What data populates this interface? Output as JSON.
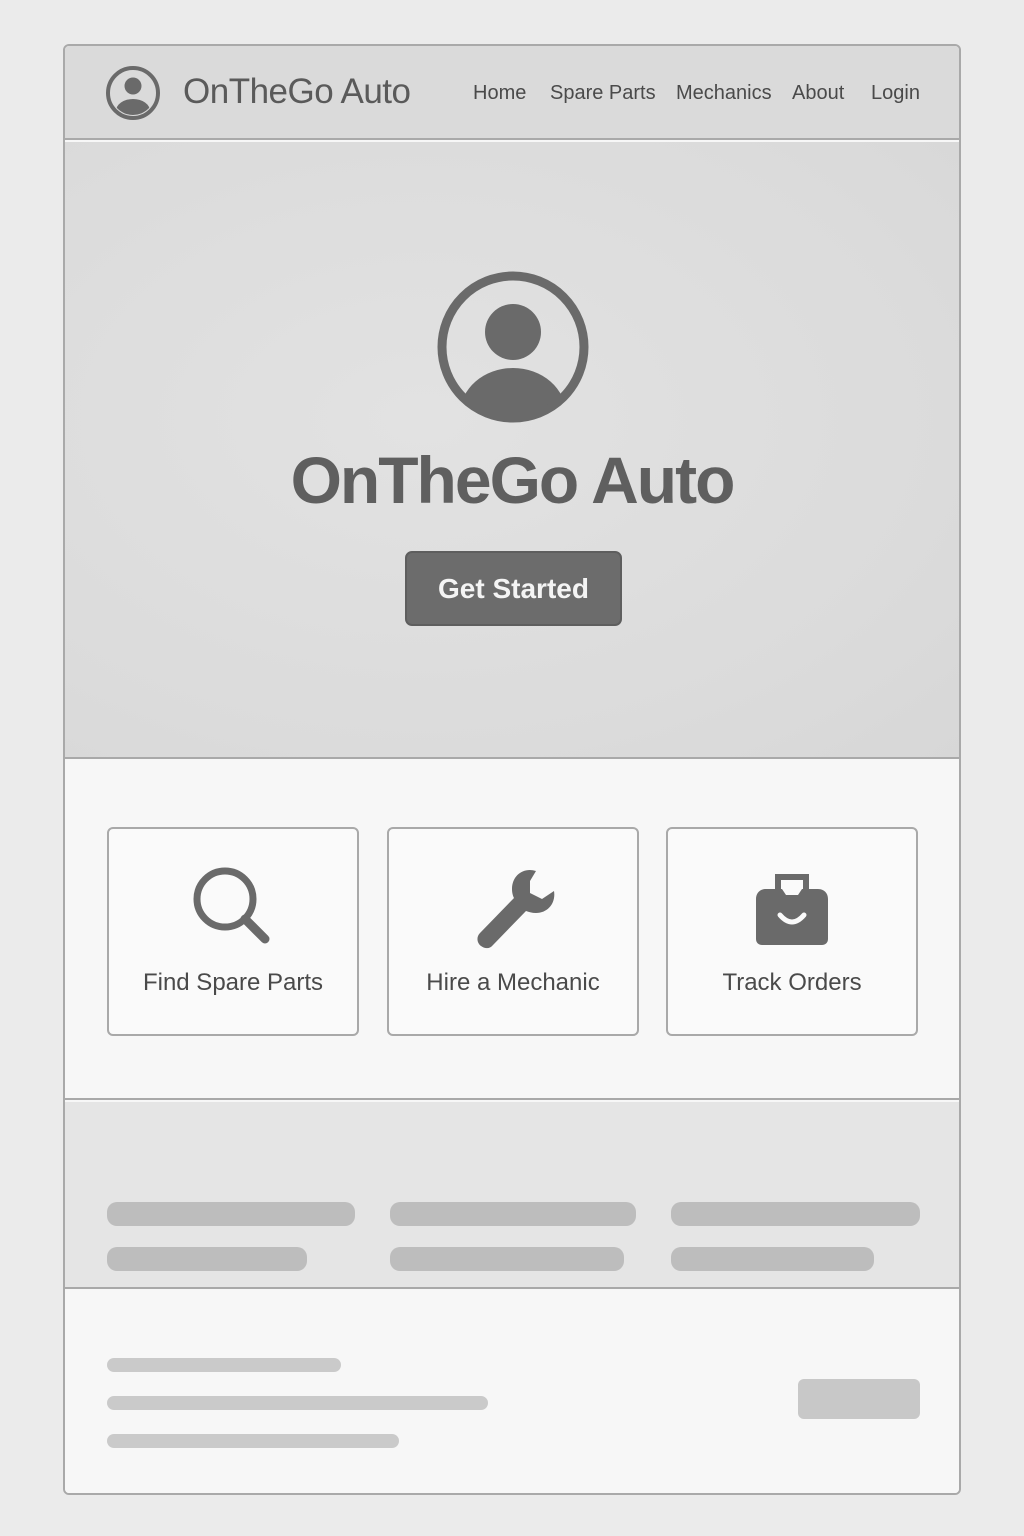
{
  "header": {
    "brand": "OnTheGo Auto",
    "logo_icon": "user-avatar-icon",
    "nav": [
      "Home",
      "Spare Parts",
      "Mechanics",
      "About",
      "Login"
    ]
  },
  "hero": {
    "icon": "user-avatar-icon",
    "title": "OnTheGo Auto",
    "cta_label": "Get Started"
  },
  "features": [
    {
      "label": "Find Spare Parts",
      "icon": "search-icon"
    },
    {
      "label": "Hire a Mechanic",
      "icon": "wrench-icon"
    },
    {
      "label": "Track Orders",
      "icon": "bag-icon"
    }
  ],
  "colors": {
    "page_bg": "#ebebeb",
    "header_bg": "#dadada",
    "hero_bg": "#dcdcdc",
    "button_bg": "#6c6c6c",
    "icon": "#6a6a6a",
    "border": "#a9a9a9",
    "placeholder": "#bdbdbd"
  }
}
